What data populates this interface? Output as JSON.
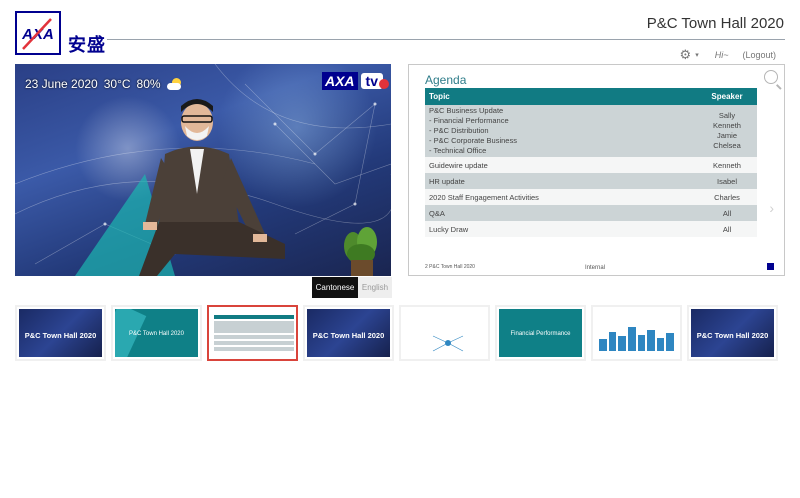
{
  "header": {
    "logo_text": "AXA",
    "logo_chinese": "安盛",
    "title": "P&C Town Hall 2020",
    "user_greeting": "Hi~",
    "logout_label": "(Logout)",
    "settings_icon": "gear-icon"
  },
  "video": {
    "date": "23 June 2020",
    "temperature": "30°C",
    "humidity": "80%",
    "weather_icon": "partly-cloudy-icon",
    "brand_axa": "AXA",
    "brand_tv": "tv"
  },
  "language": {
    "options": [
      "Cantonese",
      "English"
    ],
    "selected": "Cantonese"
  },
  "slide": {
    "title": "Agenda",
    "columns": [
      "Topic",
      "Speaker"
    ],
    "rows": [
      {
        "topic": "P&C Business Update",
        "subtopics": [
          "-  Financial Performance",
          "-  P&C Distribution",
          "-  P&C Corporate Business",
          "-  Technical Office"
        ],
        "speakers": [
          "Sally",
          "Kenneth",
          "Jamie",
          "Chelsea"
        ]
      },
      {
        "topic": "Guidewire update",
        "speakers": [
          "Kenneth"
        ]
      },
      {
        "topic": "HR update",
        "speakers": [
          "Isabel"
        ]
      },
      {
        "topic": "2020 Staff Engagement Activities",
        "speakers": [
          "Charles"
        ]
      },
      {
        "topic": "Q&A",
        "speakers": [
          "All"
        ]
      },
      {
        "topic": "Lucky Draw",
        "speakers": [
          "All"
        ]
      }
    ],
    "footer_left": "2    P&C Town Hall 2020",
    "footer_center": "Internal"
  },
  "thumbnails": [
    {
      "caption": "P&C Town Hall 2020",
      "style": "dark"
    },
    {
      "caption": "P&C Town Hall 2020",
      "style": "teal"
    },
    {
      "caption": "",
      "style": "agenda"
    },
    {
      "caption": "P&C Town Hall 2020",
      "style": "dark"
    },
    {
      "caption": "",
      "style": "white"
    },
    {
      "caption": "Financial Performance",
      "style": "teal"
    },
    {
      "caption": "",
      "style": "chart"
    },
    {
      "caption": "P&C Town Hall 2020",
      "style": "dark"
    }
  ],
  "colors": {
    "axa_blue": "#00008f",
    "teal": "#117b83",
    "selection_red": "#d9443b"
  }
}
